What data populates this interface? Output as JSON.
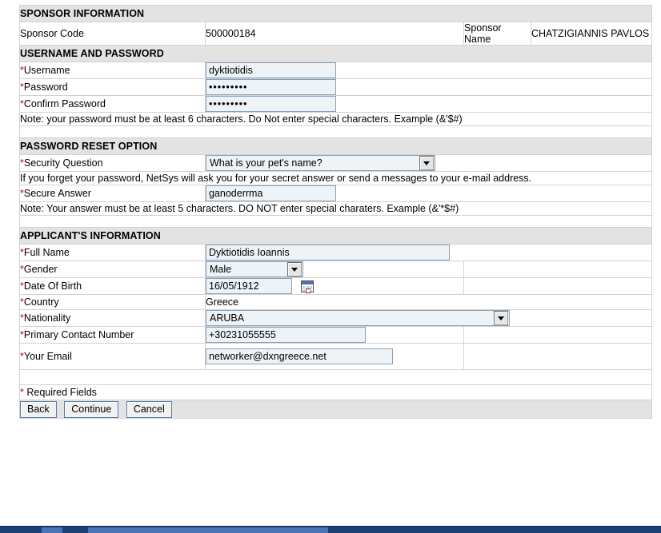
{
  "sections": {
    "sponsor": {
      "title": "SPONSOR INFORMATION",
      "sponsor_code_label": "Sponsor Code",
      "sponsor_code_value": "500000184",
      "sponsor_name_label": "Sponsor Name",
      "sponsor_name_value": "CHATZIGIANNIS PAVLOS"
    },
    "credentials": {
      "title": "USERNAME AND PASSWORD",
      "username_label": "Username",
      "username_value": "dyktiotidis",
      "password_label": "Password",
      "password_value": "•••••••••",
      "confirm_password_label": "Confirm Password",
      "confirm_password_value": "•••••••••",
      "note": "Note: your password must be at least 6 characters. Do Not enter special characters. Example (&'$#)"
    },
    "reset": {
      "title": "PASSWORD RESET OPTION",
      "security_question_label": "Security Question",
      "security_question_value": "What is your pet's name?",
      "hint": "If you forget your password, NetSys will ask you for your secret answer or send a messages to your e-mail address.",
      "secure_answer_label": "Secure Answer",
      "secure_answer_value": "ganoderrma",
      "note": "Note: Your answer must be at least 5 characters. DO NOT enter special charaters. Example (&'*$#)"
    },
    "applicant": {
      "title": "APPLICANT'S INFORMATION",
      "full_name_label": "Full Name",
      "full_name_value": "Dyktiotidis Ioannis",
      "gender_label": "Gender",
      "gender_value": "Male",
      "dob_label": "Date Of Birth",
      "dob_value": "16/05/1912",
      "calendar_icon": "calendar-icon",
      "country_label": "Country",
      "country_value": "Greece",
      "nationality_label": "Nationality",
      "nationality_value": "ARUBA",
      "phone_label": "Primary Contact Number",
      "phone_value": "+30231055555",
      "email_label": "Your Email",
      "email_value": "networker@dxngreece.net"
    }
  },
  "footer": {
    "required_marker": "*",
    "required_text": "Required Fields",
    "back_label": "Back",
    "continue_label": "Continue",
    "cancel_label": "Cancel"
  },
  "marks": {
    "asterisk": "*"
  },
  "colors": {
    "section_header_text": "#1414d2",
    "section_header_bg": "#e3e3e3",
    "required_asterisk": "#cc0000",
    "input_bg": "#eef3f8",
    "input_border": "#8ba0b5"
  }
}
